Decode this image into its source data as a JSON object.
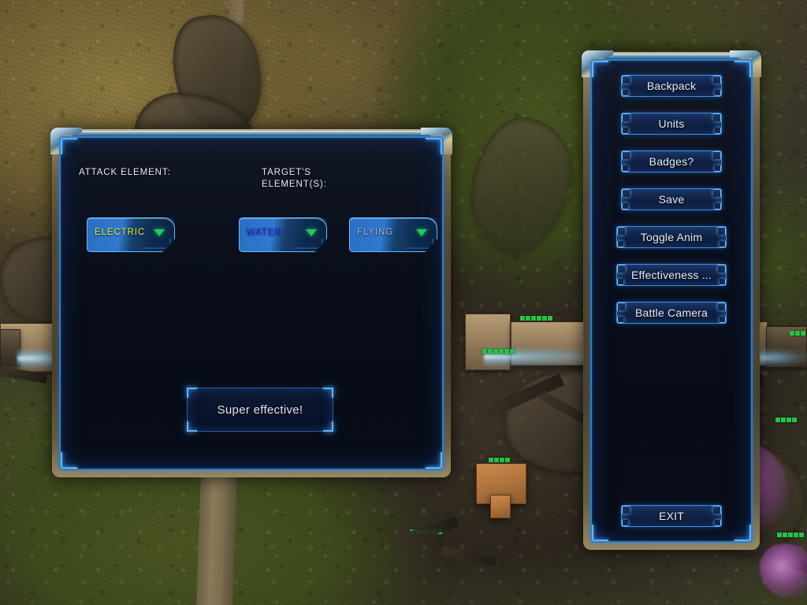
{
  "scene": {
    "description": "top-down RTS battlefield background with vehicles and terrain"
  },
  "effectiveness_panel": {
    "attack_label": "ATTACK ELEMENT:",
    "target_label": "TARGET'S\nELEMENT(S):",
    "attack_dropdown": {
      "value": "ELECTRIC",
      "color": "#e8ee2c",
      "arrow": "chevron-down-icon"
    },
    "target_dropdown_1": {
      "value": "WATER",
      "color": "#2a2cf0",
      "arrow": "chevron-down-icon"
    },
    "target_dropdown_2": {
      "value": "FLYING",
      "color": "#a9b4c4",
      "arrow": "chevron-down-icon"
    },
    "result": "Super effective!"
  },
  "game_menu": {
    "items": [
      {
        "label": "Backpack"
      },
      {
        "label": "Units"
      },
      {
        "label": "Badges?"
      },
      {
        "label": "Save"
      },
      {
        "label": "Toggle Anim"
      },
      {
        "label": "Effectiveness ..."
      },
      {
        "label": "Battle Camera"
      }
    ],
    "exit_label": "EXIT"
  },
  "theme": {
    "frame_gold": "#6d5d3c",
    "frame_blue": "#2a7fd0",
    "accent_blue": "#5fb8ff",
    "panel_bg": "#060b1a",
    "text": "#e6ecf4",
    "health_green": "#26c446"
  }
}
